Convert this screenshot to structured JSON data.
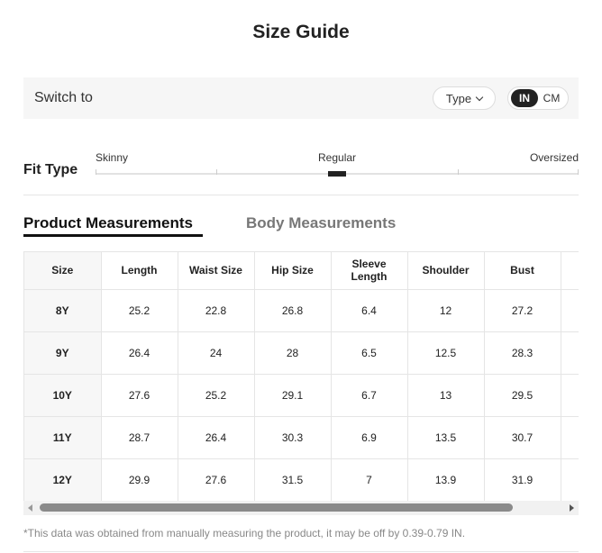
{
  "title": "Size Guide",
  "switch": {
    "label": "Switch to",
    "type_label": "Type",
    "units": [
      "IN",
      "CM"
    ],
    "active_unit": "IN"
  },
  "fit_type": {
    "label": "Fit Type",
    "options": [
      "Skinny",
      "Regular",
      "Oversized"
    ],
    "selected": "Regular"
  },
  "tabs": [
    {
      "label": "Product Measurements",
      "active": true
    },
    {
      "label": "Body Measurements",
      "active": false
    }
  ],
  "table": {
    "headers": [
      "Size",
      "Length",
      "Waist Size",
      "Hip Size",
      "Sleeve Length",
      "Shoulder",
      "Bust",
      ""
    ],
    "rows": [
      [
        "8Y",
        "25.2",
        "22.8",
        "26.8",
        "6.4",
        "12",
        "27.2",
        ""
      ],
      [
        "9Y",
        "26.4",
        "24",
        "28",
        "6.5",
        "12.5",
        "28.3",
        ""
      ],
      [
        "10Y",
        "27.6",
        "25.2",
        "29.1",
        "6.7",
        "13",
        "29.5",
        ""
      ],
      [
        "11Y",
        "28.7",
        "26.4",
        "30.3",
        "6.9",
        "13.5",
        "30.7",
        ""
      ],
      [
        "12Y",
        "29.9",
        "27.6",
        "31.5",
        "7",
        "13.9",
        "31.9",
        ""
      ]
    ]
  },
  "note": "*This data was obtained from manually measuring the product, it may be off by 0.39-0.79 IN.",
  "colors": {
    "accent": "#222222",
    "bar_bg": "#f6f6f6",
    "muted_text": "#777777"
  }
}
